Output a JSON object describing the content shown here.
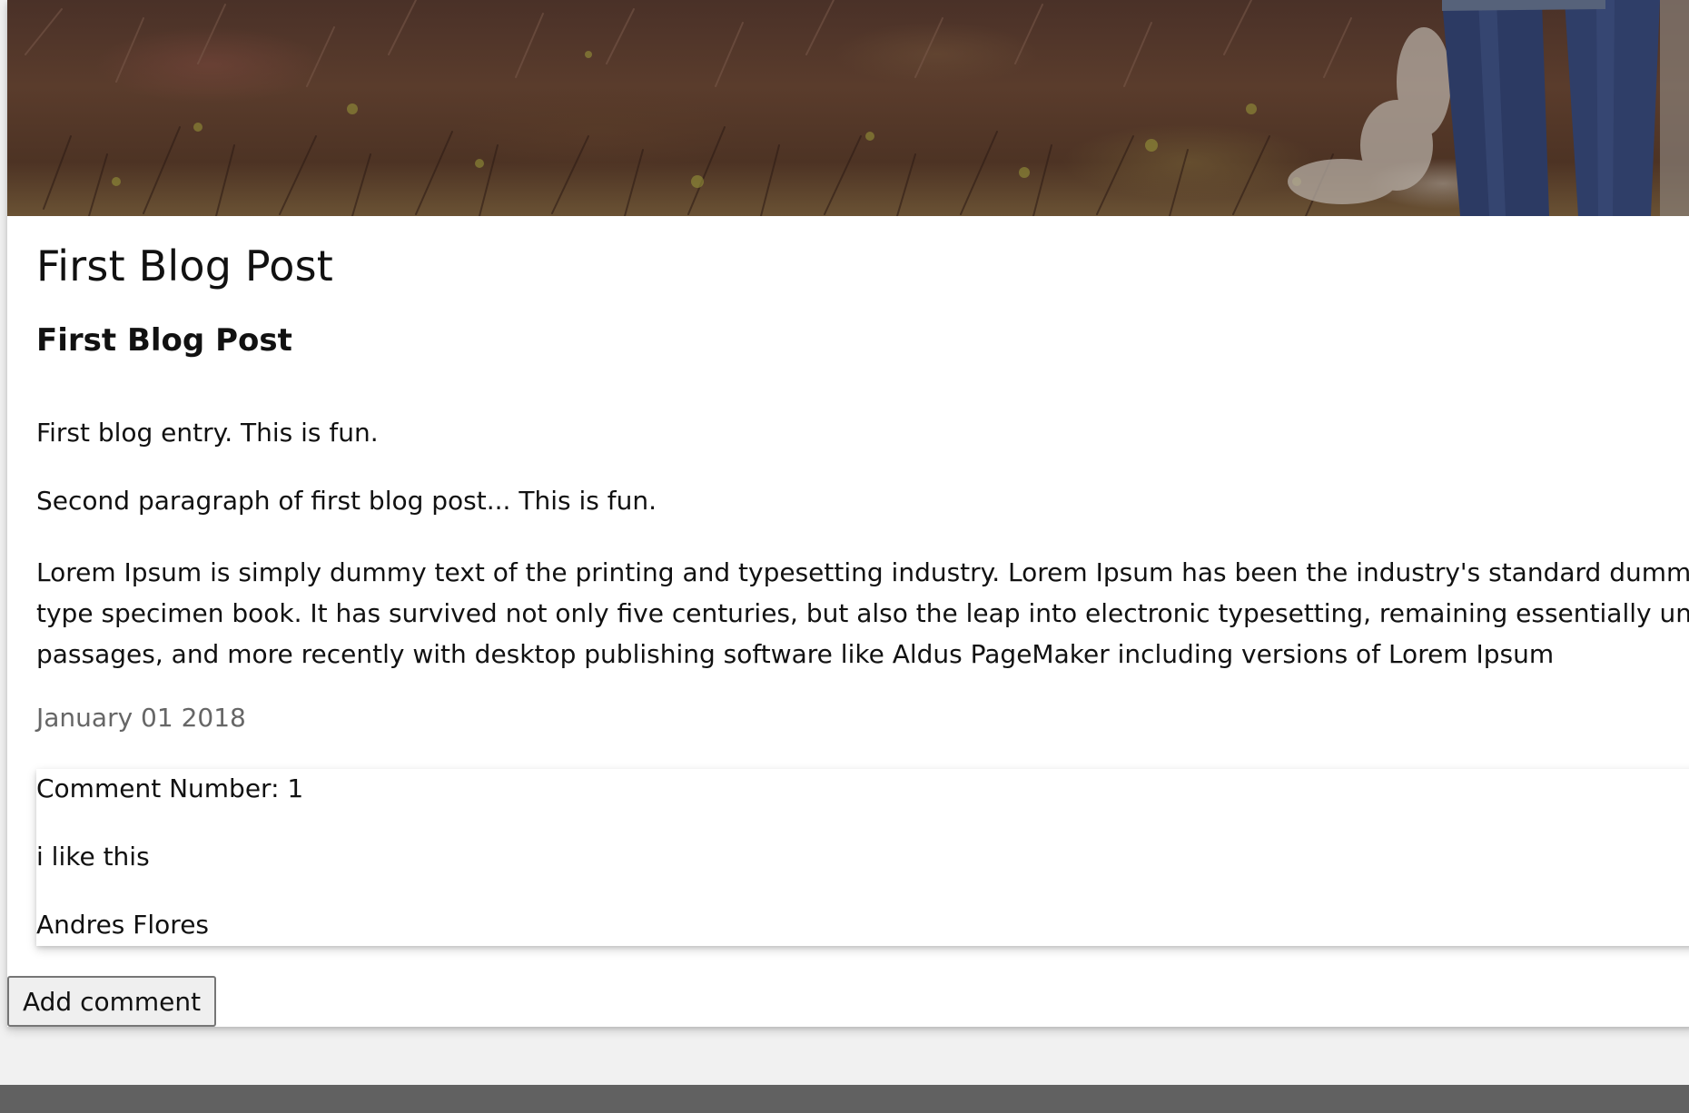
{
  "post": {
    "title": "First Blog Post",
    "subtitle": "First Blog Post",
    "paragraphs": [
      "First blog entry. This is fun.",
      "Second paragraph of first blog post... This is fun."
    ],
    "lorem_lines": [
      "Lorem Ipsum is simply dummy text of the printing and typesetting industry. Lorem Ipsum has been the industry's standard dummy te",
      "type specimen book. It has survived not only five centuries, but also the leap into electronic typesetting, remaining essentially uncha",
      "passages, and more recently with desktop publishing software like Aldus PageMaker including versions of Lorem Ipsum"
    ],
    "date": "January 01 2018"
  },
  "comment": {
    "number_label": "Comment Number: 1",
    "text": "i like this",
    "author": "Andres Flores"
  },
  "actions": {
    "add_comment_label": "Add comment"
  },
  "colors": {
    "page_background": "#f1f1f1",
    "card_background": "#ffffff",
    "date_text": "#666666",
    "footer": "#616161"
  },
  "icons": {
    "hero": "heather-path-photo"
  }
}
